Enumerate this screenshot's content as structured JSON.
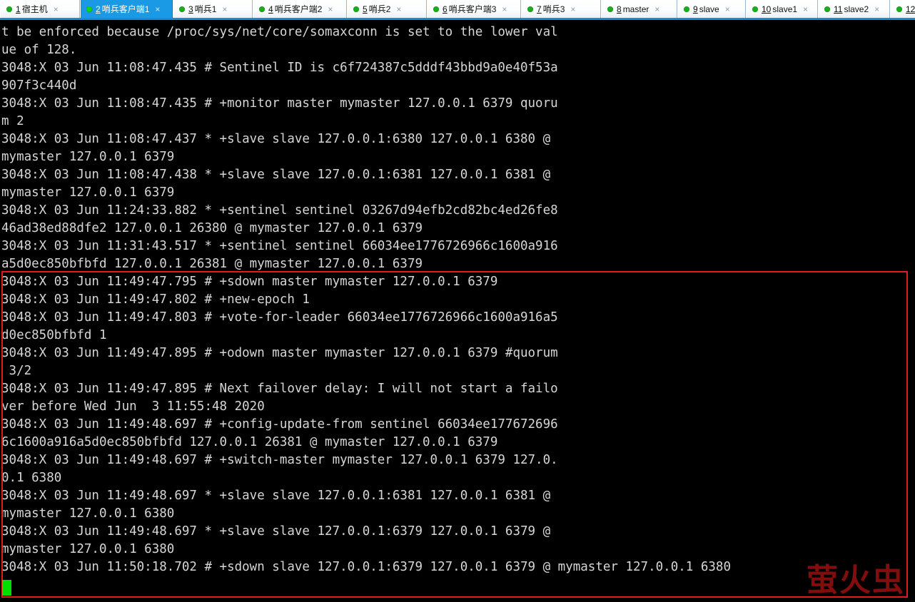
{
  "tabs": [
    {
      "num": "1",
      "label": "宿主机",
      "dot": "green-status-dot",
      "close": "×",
      "active": false,
      "width": 112
    },
    {
      "num": "2",
      "label": "哨兵客户端1",
      "dot": "green-status-dot",
      "close": "×",
      "active": true,
      "width": 130
    },
    {
      "num": "3",
      "label": "哨兵1",
      "dot": "green-status-dot",
      "close": "×",
      "active": false,
      "width": 112
    },
    {
      "num": "4",
      "label": "哨兵客户端2",
      "dot": "green-status-dot",
      "close": "×",
      "active": false,
      "width": 132
    },
    {
      "num": "5",
      "label": "哨兵2",
      "dot": "green-status-dot",
      "close": "×",
      "active": false,
      "width": 112
    },
    {
      "num": "6",
      "label": "哨兵客户端3",
      "dot": "green-status-dot",
      "close": "×",
      "active": false,
      "width": 132
    },
    {
      "num": "7",
      "label": "哨兵3",
      "dot": "green-status-dot",
      "close": "×",
      "active": false,
      "width": 112
    },
    {
      "num": "8",
      "label": "master",
      "dot": "green-status-dot",
      "close": "×",
      "active": false,
      "width": 107
    },
    {
      "num": "9",
      "label": "slave",
      "dot": "green-status-dot",
      "close": "×",
      "active": false,
      "width": 96
    },
    {
      "num": "10",
      "label": "slave1",
      "dot": "green-status-dot",
      "close": "×",
      "active": false,
      "width": 101
    },
    {
      "num": "11",
      "label": "slave2",
      "dot": "green-status-dot",
      "close": "×",
      "active": false,
      "width": 101
    },
    {
      "num": "12",
      "label": "",
      "dot": "green-status-dot",
      "close": "",
      "active": false,
      "width": 40
    }
  ],
  "terminal": {
    "cursor": "block-cursor",
    "watermark": "萤火虫",
    "colors": {
      "background": "#000000",
      "foreground": "#d6d6d6",
      "cursor": "#00e000",
      "highlight_box": "#e01b1b",
      "watermark": "#8d0f0f",
      "active_tab": "#1a9ae4",
      "status_dot": "#17b117"
    },
    "lines": [
      "t be enforced because /proc/sys/net/core/somaxconn is set to the lower val",
      "ue of 128.",
      "3048:X 03 Jun 11:08:47.435 # Sentinel ID is c6f724387c5dddf43bbd9a0e40f53a",
      "907f3c440d",
      "3048:X 03 Jun 11:08:47.435 # +monitor master mymaster 127.0.0.1 6379 quoru",
      "m 2",
      "3048:X 03 Jun 11:08:47.437 * +slave slave 127.0.0.1:6380 127.0.0.1 6380 @",
      "mymaster 127.0.0.1 6379",
      "3048:X 03 Jun 11:08:47.438 * +slave slave 127.0.0.1:6381 127.0.0.1 6381 @",
      "mymaster 127.0.0.1 6379",
      "3048:X 03 Jun 11:24:33.882 * +sentinel sentinel 03267d94efb2cd82bc4ed26fe8",
      "46ad38ed88dfe2 127.0.0.1 26380 @ mymaster 127.0.0.1 6379",
      "3048:X 03 Jun 11:31:43.517 * +sentinel sentinel 66034ee1776726966c1600a916",
      "a5d0ec850bfbfd 127.0.0.1 26381 @ mymaster 127.0.0.1 6379",
      "3048:X 03 Jun 11:49:47.795 # +sdown master mymaster 127.0.0.1 6379",
      "3048:X 03 Jun 11:49:47.802 # +new-epoch 1",
      "3048:X 03 Jun 11:49:47.803 # +vote-for-leader 66034ee1776726966c1600a916a5",
      "d0ec850bfbfd 1",
      "3048:X 03 Jun 11:49:47.895 # +odown master mymaster 127.0.0.1 6379 #quorum",
      " 3/2",
      "3048:X 03 Jun 11:49:47.895 # Next failover delay: I will not start a failo",
      "ver before Wed Jun  3 11:55:48 2020",
      "3048:X 03 Jun 11:49:48.697 # +config-update-from sentinel 66034ee177672696",
      "6c1600a916a5d0ec850bfbfd 127.0.0.1 26381 @ mymaster 127.0.0.1 6379",
      "3048:X 03 Jun 11:49:48.697 # +switch-master mymaster 127.0.0.1 6379 127.0.",
      "0.1 6380",
      "3048:X 03 Jun 11:49:48.697 * +slave slave 127.0.0.1:6381 127.0.0.1 6381 @",
      "mymaster 127.0.0.1 6380",
      "3048:X 03 Jun 11:49:48.697 * +slave slave 127.0.0.1:6379 127.0.0.1 6379 @",
      "mymaster 127.0.0.1 6380",
      "3048:X 03 Jun 11:50:18.702 # +sdown slave 127.0.0.1:6379 127.0.0.1 6379 @ mymaster 127.0.0.1 6380"
    ]
  }
}
